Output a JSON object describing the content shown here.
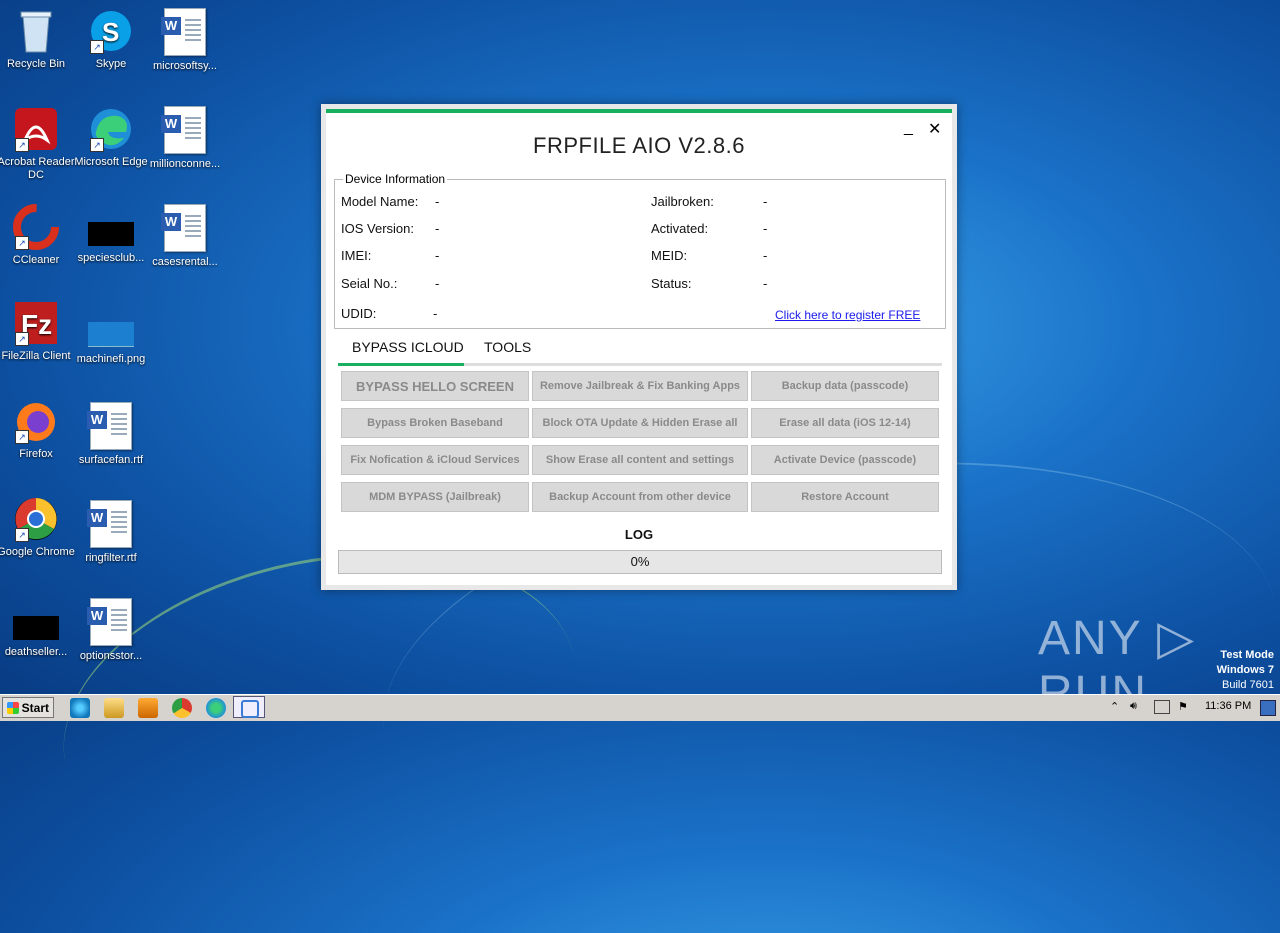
{
  "desktop": {
    "icons": [
      {
        "label": "Recycle Bin"
      },
      {
        "label": "Skype"
      },
      {
        "label": "microsoftsy..."
      },
      {
        "label": "Acrobat Reader DC"
      },
      {
        "label": "Microsoft Edge"
      },
      {
        "label": "millionconne..."
      },
      {
        "label": "CCleaner"
      },
      {
        "label": "speciesclub..."
      },
      {
        "label": "casesrental..."
      },
      {
        "label": "FileZilla Client"
      },
      {
        "label": "machinefi.png"
      },
      {
        "label": "Firefox"
      },
      {
        "label": "surfacefan.rtf"
      },
      {
        "label": "Google Chrome"
      },
      {
        "label": "ringfilter.rtf"
      },
      {
        "label": "deathseller..."
      },
      {
        "label": "optionsstor..."
      }
    ]
  },
  "window": {
    "title": "FRPFILE AIO V2.8.6",
    "minimize": "_",
    "close": "✕",
    "device_info": {
      "legend": "Device Information",
      "model_label": "Model Name:",
      "model_value": "-",
      "ios_label": "IOS Version:",
      "ios_value": "-",
      "imei_label": "IMEI:",
      "imei_value": "-",
      "serial_label": "Seial No.:",
      "serial_value": "-",
      "udid_label": "UDID:",
      "udid_value": "-",
      "jailbroken_label": "Jailbroken:",
      "jailbroken_value": "-",
      "activated_label": "Activated:",
      "activated_value": "-",
      "meid_label": "MEID:",
      "meid_value": "-",
      "status_label": "Status:",
      "status_value": "-",
      "register_link": "Click here to register FREE"
    },
    "tabs": [
      {
        "label": "BYPASS ICLOUD"
      },
      {
        "label": "TOOLS"
      }
    ],
    "buttons": [
      "BYPASS HELLO SCREEN",
      "Remove Jailbreak & Fix Banking Apps",
      "Backup data (passcode)",
      "Bypass Broken Baseband",
      "Block OTA Update & Hidden Erase all",
      "Erase all data (iOS 12-14)",
      "Fix Nofication & iCloud Services",
      "Show Erase all content and settings",
      "Activate Device (passcode)",
      "MDM BYPASS (Jailbreak)",
      "Backup Account from other device",
      "Restore Account"
    ],
    "log_label": "LOG",
    "progress_text": "0%",
    "progress_value": 0
  },
  "watermark": {
    "text": "ANY RUN",
    "test_mode": "Test Mode",
    "os": "Windows 7",
    "build": "Build 7601"
  },
  "taskbar": {
    "start_label": "Start",
    "clock": "11:36 PM"
  }
}
